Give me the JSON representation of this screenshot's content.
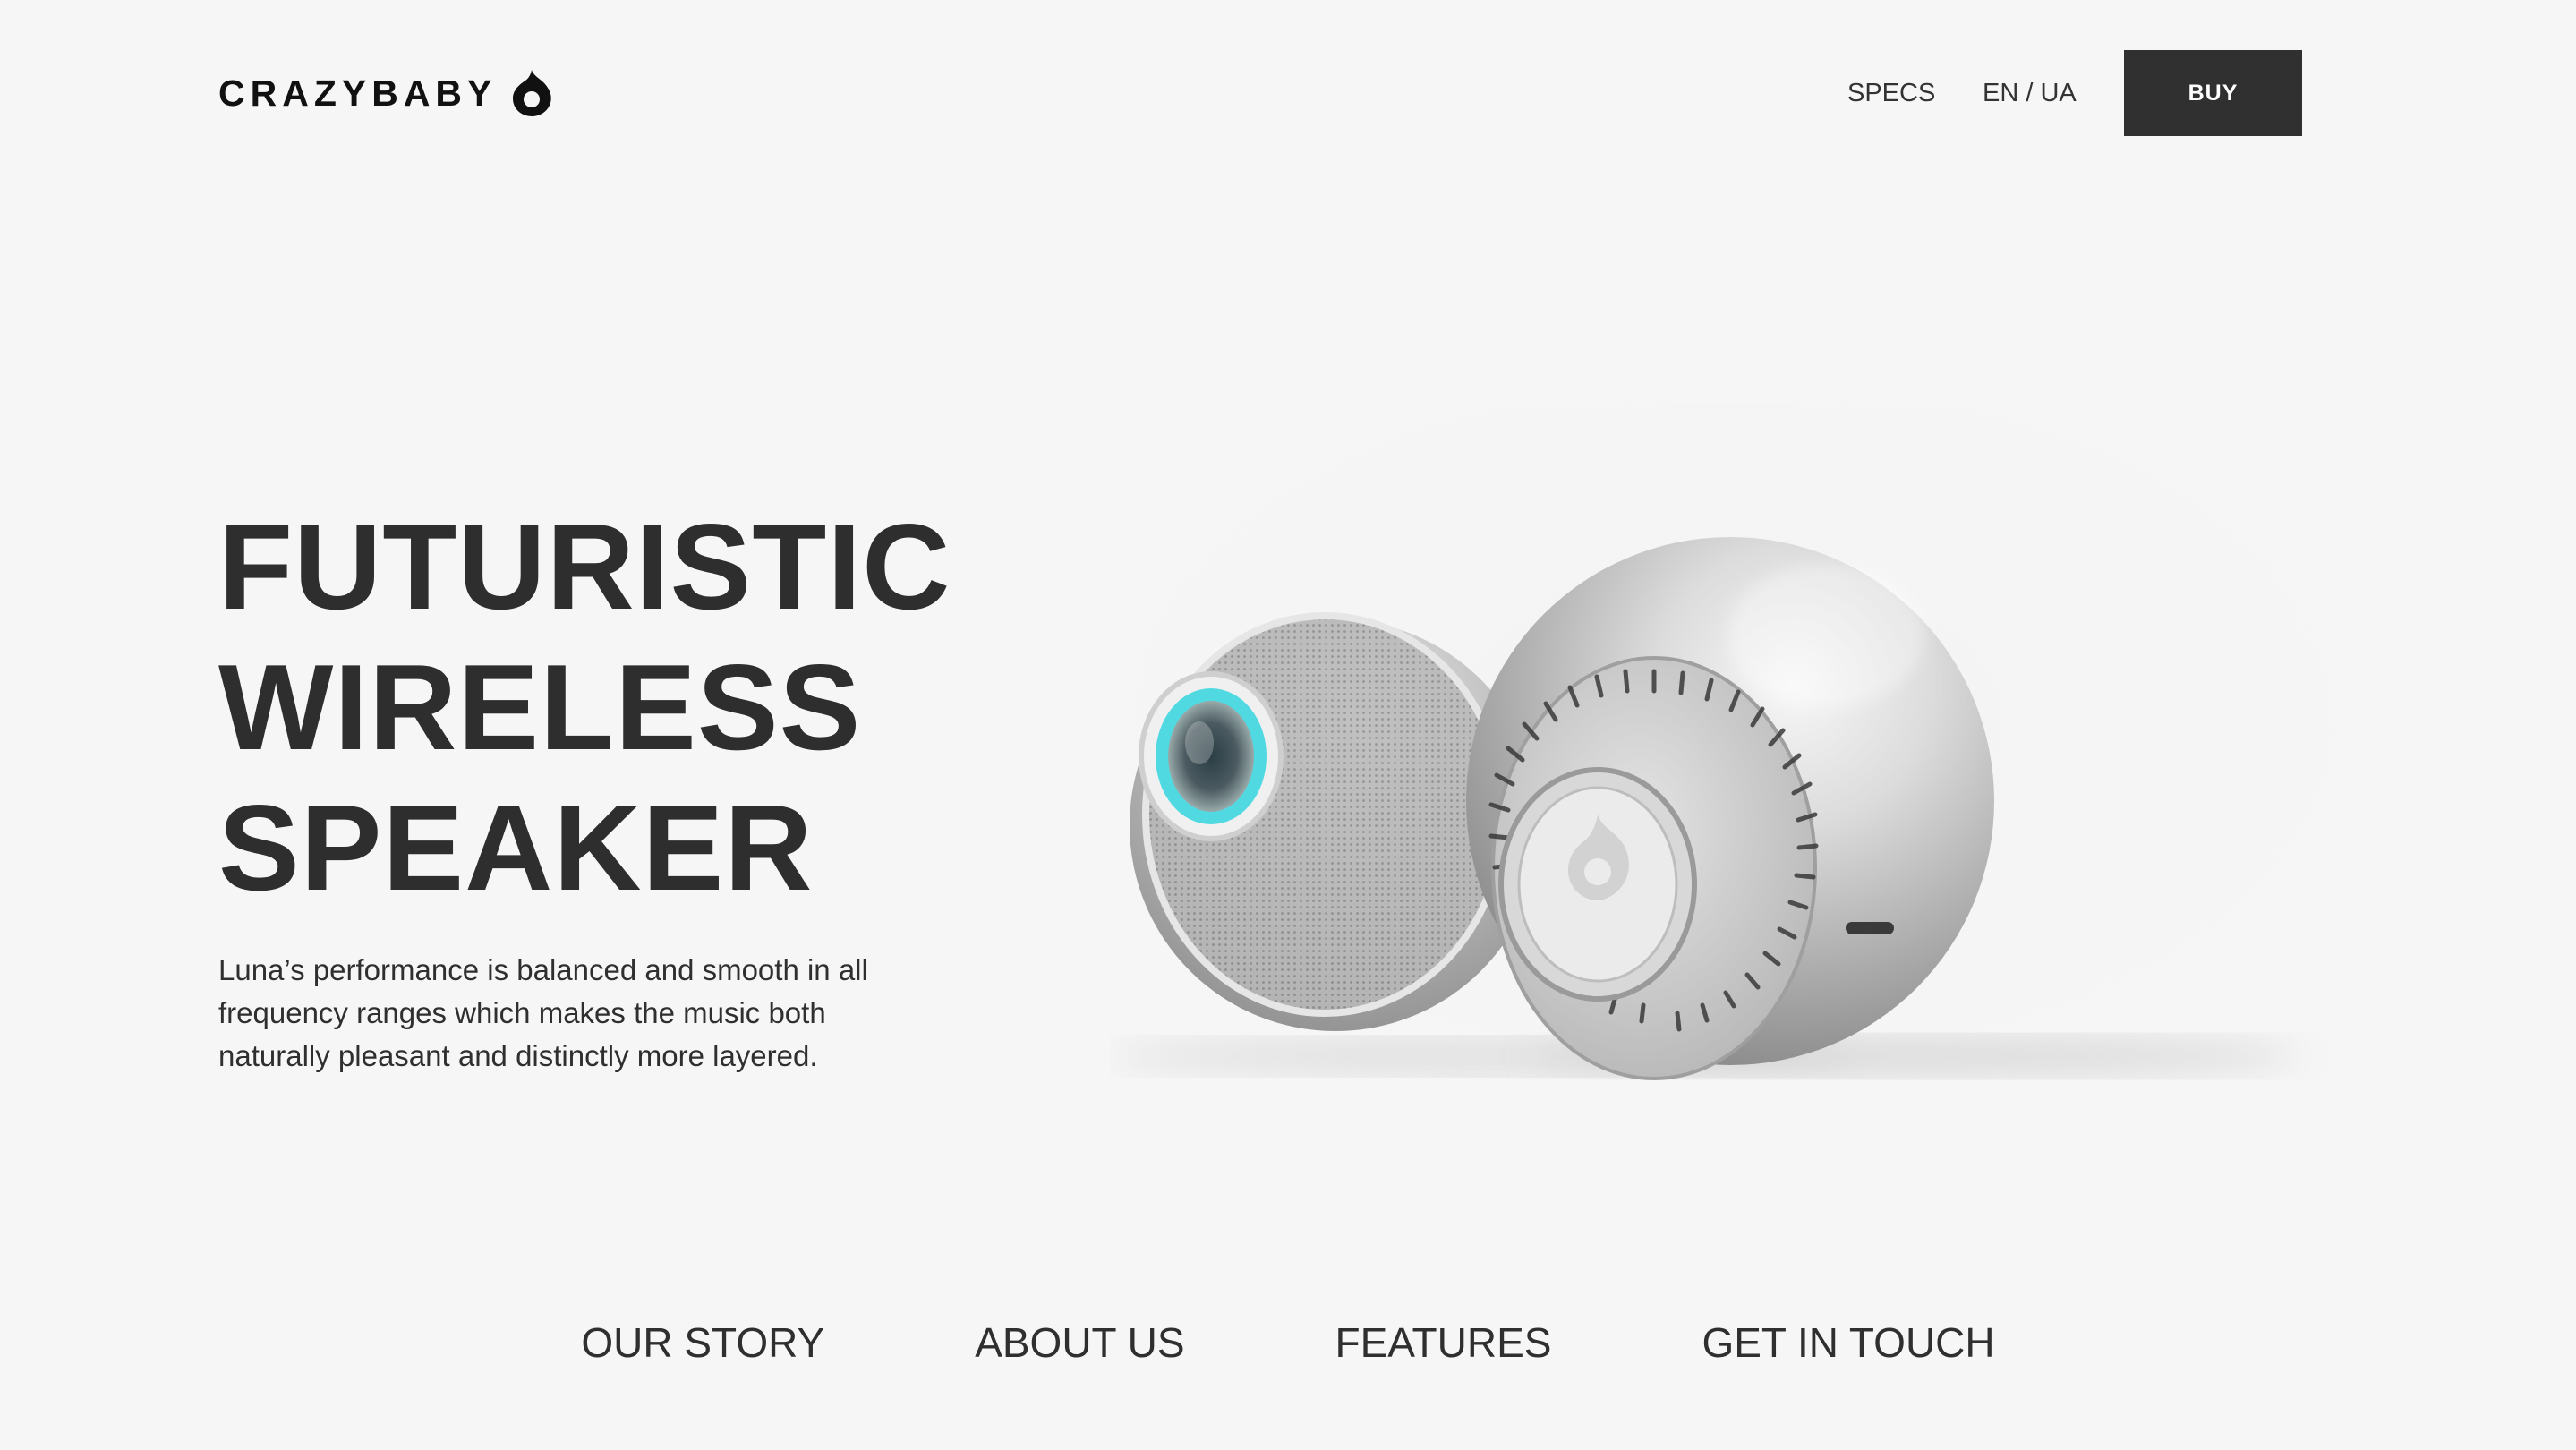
{
  "header": {
    "brand": "CRAZYBABY",
    "nav": {
      "specs_label": "SPECS",
      "lang_label": "EN / UA"
    },
    "buy_label": "BUY"
  },
  "hero": {
    "title_lines": [
      "FUTURISTIC",
      "WIRELESS",
      "SPEAKER"
    ],
    "description": "Luna’s performance is balanced and smooth in all frequency ranges which makes the music both naturally pleasant and distinctly more layered.",
    "image_alt": "Two silver spherical speakers"
  },
  "bottom_nav": {
    "items": [
      {
        "label": "OUR STORY"
      },
      {
        "label": "ABOUT US"
      },
      {
        "label": "FEATURES"
      },
      {
        "label": "GET IN TOUCH"
      }
    ]
  },
  "colors": {
    "background": "#f6f6f6",
    "text": "#2f2f2f",
    "button": "#303030",
    "accent_ring": "#3fd6e0"
  },
  "icons": {
    "logo_mark": "drop-logo-icon"
  }
}
